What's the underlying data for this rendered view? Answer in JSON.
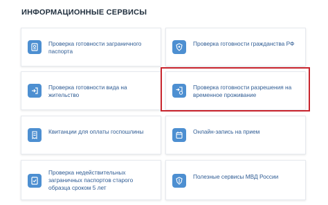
{
  "section_title": "ИНФОРМАЦИОННЫЕ СЕРВИСЫ",
  "cards": [
    {
      "label": "Проверка готовности заграничного паспорта",
      "icon": "passport-icon"
    },
    {
      "label": "Проверка готовности гражданства РФ",
      "icon": "emblem-icon"
    },
    {
      "label": "Проверка готовности вида на жительство",
      "icon": "enter-icon"
    },
    {
      "label": "Проверка готовности разрешения на временное проживание",
      "icon": "enter-clock-icon"
    },
    {
      "label": "Квитанции для оплаты госпошлины",
      "icon": "receipt-icon"
    },
    {
      "label": "Онлайн-запись на прием",
      "icon": "calendar-icon"
    },
    {
      "label": "Проверка недействительных заграничных паспортов старого образца сроком 5 лет",
      "icon": "passport-check-icon"
    },
    {
      "label": "Полезные сервисы МВД России",
      "icon": "mvd-emblem-icon"
    }
  ],
  "colors": {
    "accent": "#4d8fd1",
    "link_text": "#2e5b93",
    "highlight_border": "#c8232c",
    "title_text": "#1f2e3d"
  }
}
